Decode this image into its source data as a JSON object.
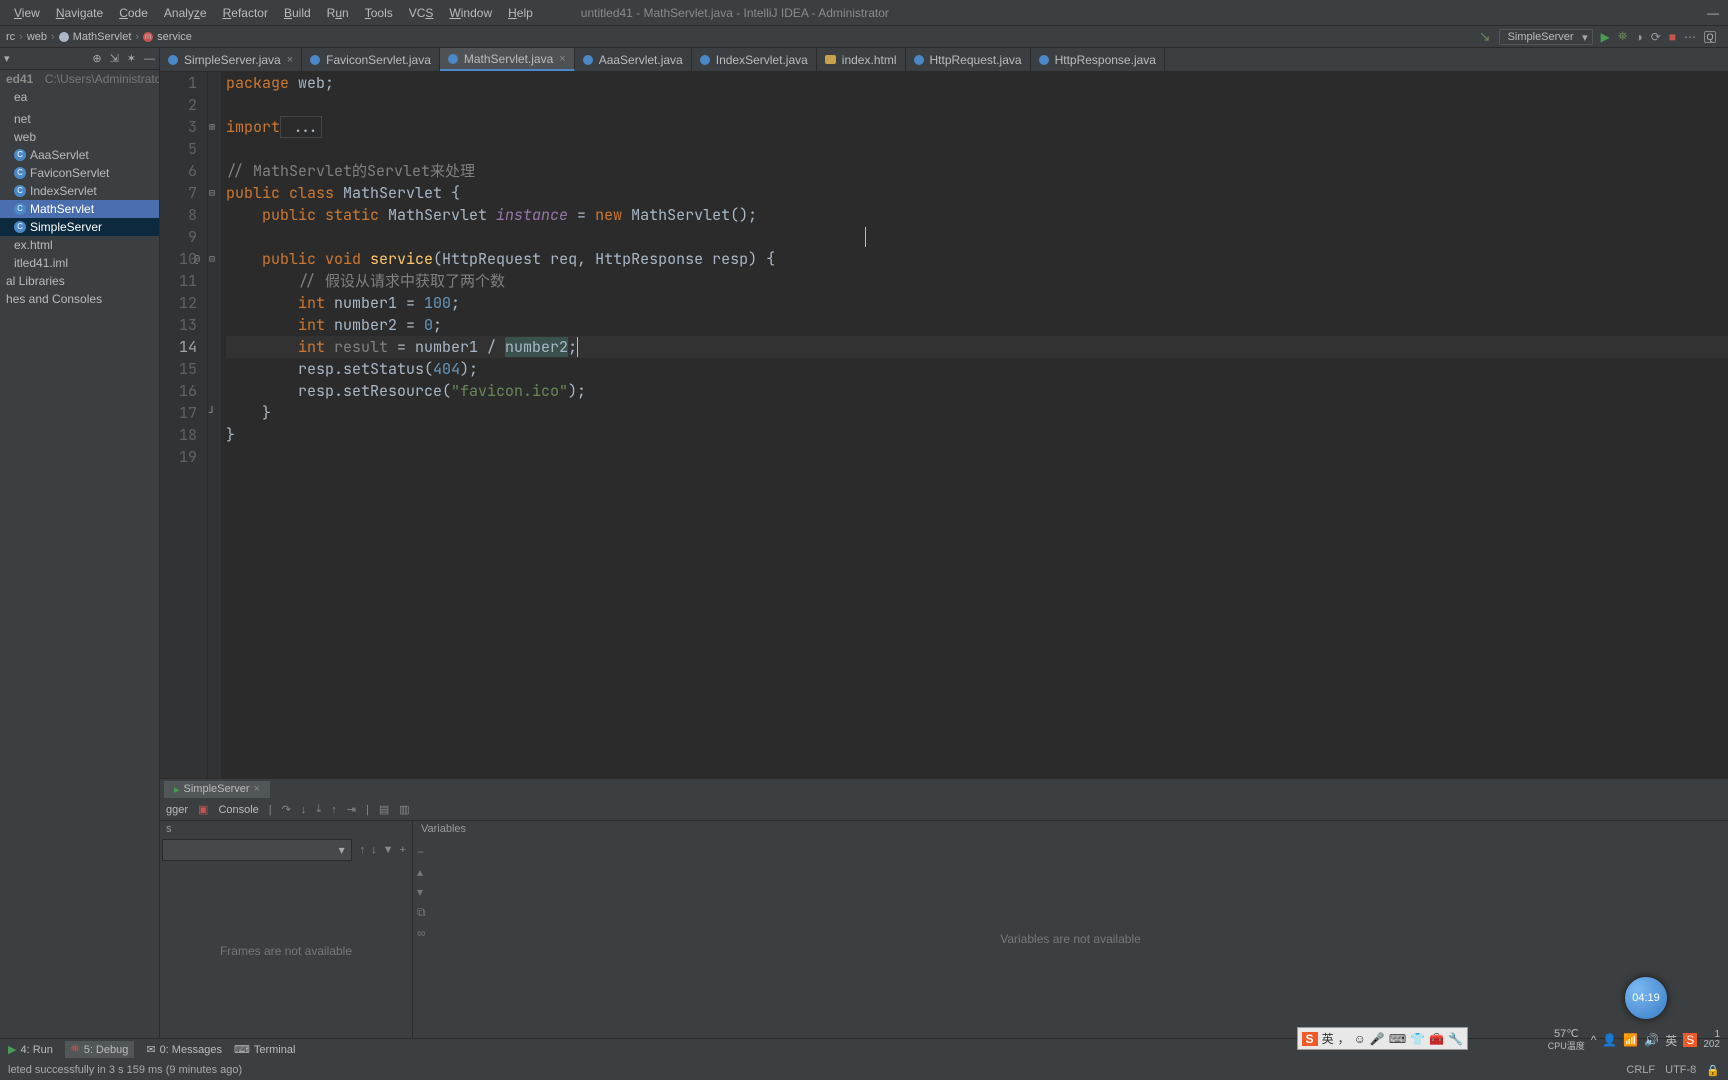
{
  "title": "untitled41 - MathServlet.java - IntelliJ IDEA - Administrator",
  "menu": [
    "View",
    "Navigate",
    "Code",
    "Analyze",
    "Refactor",
    "Build",
    "Run",
    "Tools",
    "VCS",
    "Window",
    "Help"
  ],
  "breadcrumb": [
    "rc",
    "web",
    "MathServlet",
    "service"
  ],
  "runConfig": "SimpleServer",
  "project": {
    "root": "ed41",
    "rootPath": "C:\\Users\\Administrator\\Idea",
    "items": [
      {
        "label": "ea",
        "kind": "folder"
      },
      {
        "label": "",
        "kind": "folder"
      },
      {
        "label": "net",
        "kind": "pkg"
      },
      {
        "label": "web",
        "kind": "pkg"
      },
      {
        "label": "AaaServlet",
        "kind": "class"
      },
      {
        "label": "FaviconServlet",
        "kind": "class"
      },
      {
        "label": "IndexServlet",
        "kind": "class"
      },
      {
        "label": "MathServlet",
        "kind": "class",
        "sel": true
      },
      {
        "label": "SimpleServer",
        "kind": "class",
        "sel2": true
      },
      {
        "label": "ex.html",
        "kind": "file"
      },
      {
        "label": "itled41.iml",
        "kind": "file"
      },
      {
        "label": "al Libraries",
        "kind": "lib"
      },
      {
        "label": "hes and Consoles",
        "kind": "lib"
      }
    ]
  },
  "tabs": [
    {
      "label": "SimpleServer.java",
      "icon": "blue"
    },
    {
      "label": "FaviconServlet.java",
      "icon": "blue"
    },
    {
      "label": "MathServlet.java",
      "icon": "blue",
      "active": true
    },
    {
      "label": "AaaServlet.java",
      "icon": "blue"
    },
    {
      "label": "IndexServlet.java",
      "icon": "blue"
    },
    {
      "label": "index.html",
      "icon": "orange"
    },
    {
      "label": "HttpRequest.java",
      "icon": "blue"
    },
    {
      "label": "HttpResponse.java",
      "icon": "blue"
    }
  ],
  "code": {
    "l1": {
      "kw": "package",
      "rest": " web;"
    },
    "l3": {
      "kw": "import",
      "rest": " ..."
    },
    "l6c": "// MathServlet的Servlet来处理",
    "l7a": "public ",
    "l7b": "class ",
    "l7c": "MathServlet {",
    "l8a": "    public static ",
    "l8b": "MathServlet ",
    "l8c": "instance",
    "l8d": " = ",
    "l8e": "new ",
    "l8f": "MathServlet();",
    "l10a": "    public ",
    "l10k": "void ",
    "l10f": "service",
    "l10p": "(HttpRequest ",
    "l10q": "req",
    "l10r": ", HttpResponse ",
    "l10s": "resp",
    "l10t": ") {",
    "l11c": "        // 假设从请求中获取了两个数",
    "l12a": "        int ",
    "l12b": "number1 = ",
    "l12n": "100",
    "l12e": ";",
    "l13a": "        int ",
    "l13b": "number2 = ",
    "l13n": "0",
    "l13e": ";",
    "l14a": "        int ",
    "l14b": "result",
    "l14c": " = number1 / ",
    "l14d": "number2",
    "l14e": ";",
    "l15a": "        resp.setStatus(",
    "l15n": "404",
    "l15b": ");",
    "l16a": "        resp.setResource(",
    "l16s": "\"favicon.ico\"",
    "l16b": ");",
    "l17": "    }",
    "l18": "}"
  },
  "lineNums": [
    "1",
    "2",
    "3",
    "5",
    "6",
    "7",
    "8",
    "9",
    "10",
    "11",
    "12",
    "13",
    "14",
    "15",
    "16",
    "17",
    "18",
    "19"
  ],
  "curLine": "14",
  "ann": "@",
  "debugger": {
    "tabName": "SimpleServer",
    "subTabs": {
      "debugger": "gger",
      "console": "Console"
    },
    "framesHdr": "s",
    "varsHdr": "Variables",
    "framesMsg": "Frames are not available",
    "varsMsg": "Variables are not available"
  },
  "bottomTools": {
    "run": "4: Run",
    "debug": "5: Debug",
    "messages": "0: Messages",
    "terminal": "Terminal"
  },
  "status": {
    "msg": "leted successfully in 3 s 159 ms (9 minutes ago)",
    "crlf": "CRLF",
    "enc": "UTF-8"
  },
  "badgeTime": "04:19",
  "ime": {
    "brand": "S",
    "lang": "英"
  },
  "tray": {
    "temp": "57℃",
    "label": "CPU温度",
    "lang": "英",
    "year": "202",
    "time": "1"
  }
}
